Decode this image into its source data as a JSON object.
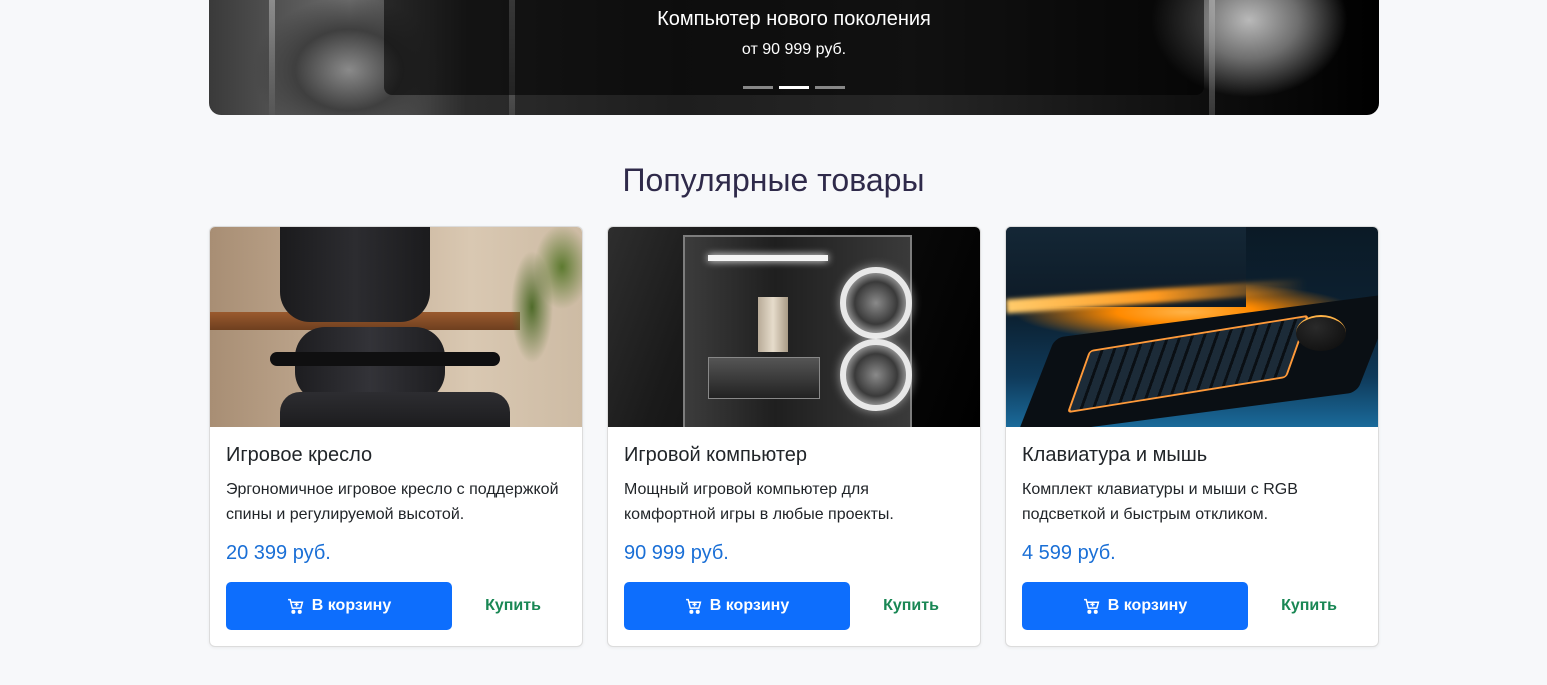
{
  "hero": {
    "title": "Компьютер нового поколения",
    "subtitle": "от 90 999 руб.",
    "slides_count": 3,
    "active_slide": 2
  },
  "section": {
    "title": "Популярные товары"
  },
  "products": [
    {
      "title": "Игровое кресло",
      "description": "Эргономичное игровое кресло с поддержкой спины и регулируемой высотой.",
      "price": "20 399 руб.",
      "cart_label": "В корзину",
      "buy_label": "Купить",
      "image": "gaming-chair"
    },
    {
      "title": "Игровой компьютер",
      "description": "Мощный игровой компьютер для комфортной игры в любые проекты.",
      "price": "90 999 руб.",
      "cart_label": "В корзину",
      "buy_label": "Купить",
      "image": "gaming-pc"
    },
    {
      "title": "Клавиатура и мышь",
      "description": "Комплект клавиатуры и мыши с RGB подсветкой и быстрым откликом.",
      "price": "4 599 руб.",
      "cart_label": "В корзину",
      "buy_label": "Купить",
      "image": "keyboard-mouse"
    }
  ],
  "icons": {
    "cart": "cart-icon"
  },
  "colors": {
    "primary": "#0d6efd",
    "success": "#198754",
    "price": "#1a6fd6",
    "heading": "#2f2a4a"
  }
}
